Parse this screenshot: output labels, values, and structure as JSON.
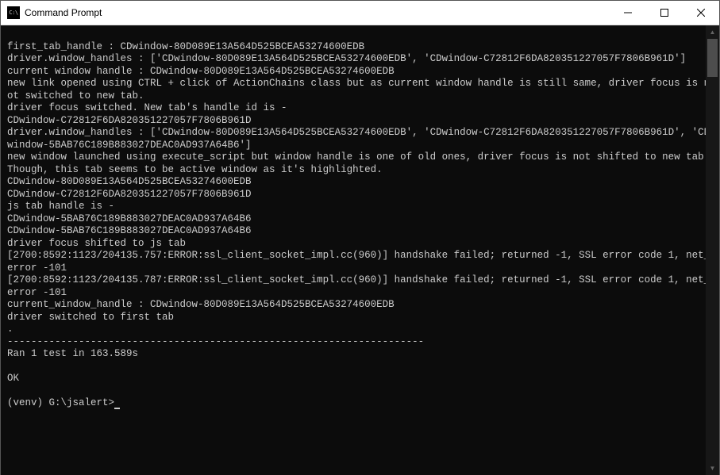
{
  "titlebar": {
    "icon_text": "C:\\",
    "title": "Command Prompt"
  },
  "terminal": {
    "lines": [
      "",
      "first_tab_handle : CDwindow-80D089E13A564D525BCEA53274600EDB",
      "driver.window_handles : ['CDwindow-80D089E13A564D525BCEA53274600EDB', 'CDwindow-C72812F6DA820351227057F7806B961D']",
      "current window handle : CDwindow-80D089E13A564D525BCEA53274600EDB",
      "new link opened using CTRL + click of ActionChains class but as current window handle is still same, driver focus is not switched to new tab.",
      "driver focus switched. New tab's handle id is -",
      "CDwindow-C72812F6DA820351227057F7806B961D",
      "driver.window_handles : ['CDwindow-80D089E13A564D525BCEA53274600EDB', 'CDwindow-C72812F6DA820351227057F7806B961D', 'CDwindow-5BAB76C189B883027DEAC0AD937A64B6']",
      "new window launched using execute_script but window handle is one of old ones, driver focus is not shifted to new tab. Though, this tab seems to be active window as it's highlighted.",
      "CDwindow-80D089E13A564D525BCEA53274600EDB",
      "CDwindow-C72812F6DA820351227057F7806B961D",
      "js tab handle is -",
      "CDwindow-5BAB76C189B883027DEAC0AD937A64B6",
      "CDwindow-5BAB76C189B883027DEAC0AD937A64B6",
      "driver focus shifted to js tab",
      "[2700:8592:1123/204135.757:ERROR:ssl_client_socket_impl.cc(960)] handshake failed; returned -1, SSL error code 1, net_error -101",
      "[2700:8592:1123/204135.787:ERROR:ssl_client_socket_impl.cc(960)] handshake failed; returned -1, SSL error code 1, net_error -101",
      "current_window_handle : CDwindow-80D089E13A564D525BCEA53274600EDB",
      "driver switched to first tab",
      ".",
      "----------------------------------------------------------------------",
      "Ran 1 test in 163.589s",
      "",
      "OK",
      ""
    ],
    "prompt": "(venv) G:\\jsalert>"
  }
}
